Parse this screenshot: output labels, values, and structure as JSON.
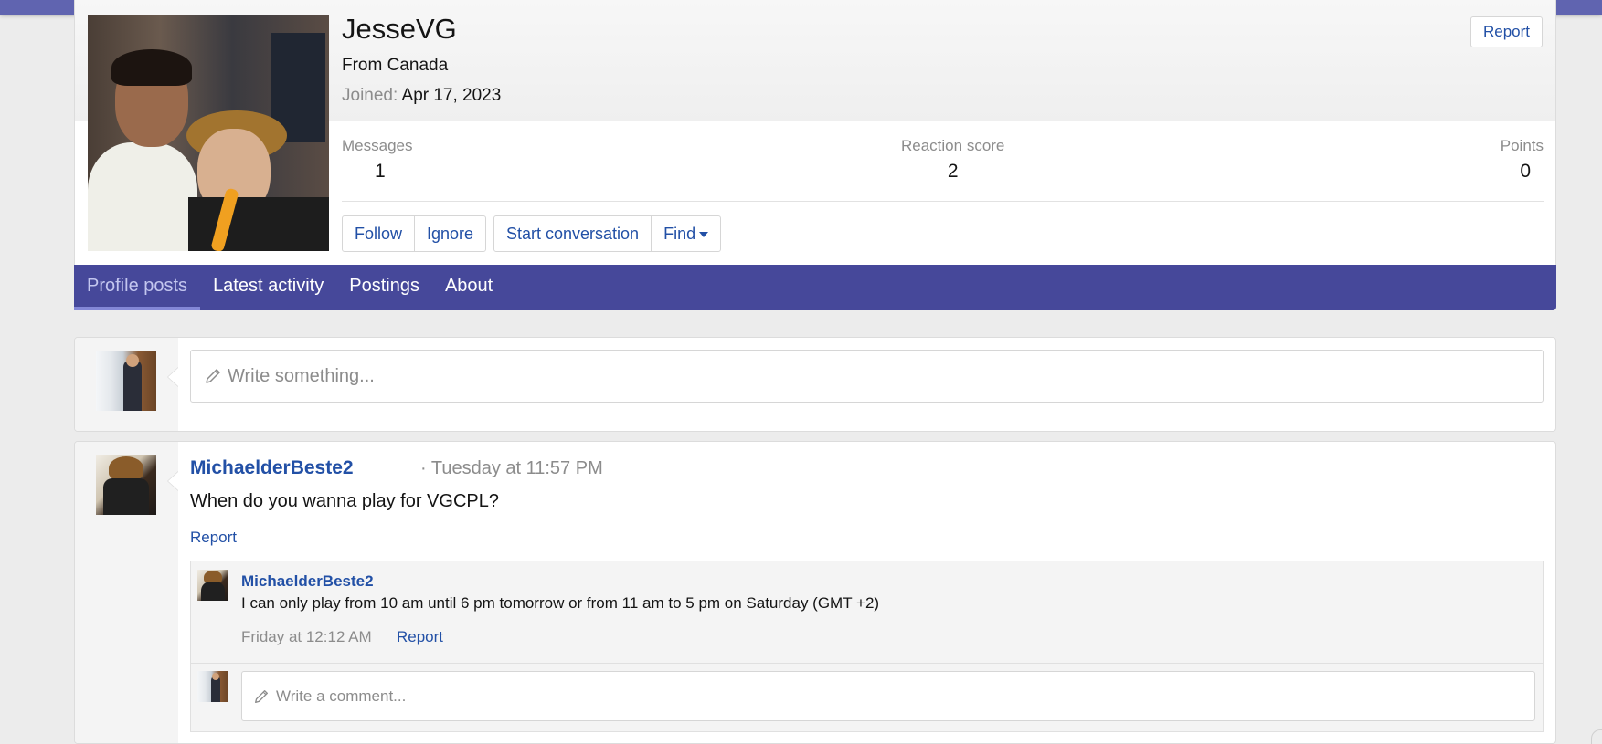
{
  "profile": {
    "username": "JesseVG",
    "location": "From Canada",
    "joined_label": "Joined:",
    "joined_date": "Apr 17, 2023",
    "report_label": "Report",
    "stats": {
      "messages_label": "Messages",
      "messages_value": "1",
      "reaction_label": "Reaction score",
      "reaction_value": "2",
      "points_label": "Points",
      "points_value": "0"
    },
    "actions": {
      "follow": "Follow",
      "ignore": "Ignore",
      "start_conversation": "Start conversation",
      "find": "Find"
    }
  },
  "tabs": [
    {
      "label": "Profile posts",
      "active": true
    },
    {
      "label": "Latest activity",
      "active": false
    },
    {
      "label": "Postings",
      "active": false
    },
    {
      "label": "About",
      "active": false
    }
  ],
  "composer": {
    "placeholder": "Write something..."
  },
  "post": {
    "author": "MichaelderBeste2",
    "time": "· Tuesday at 11:57 PM",
    "body": "When do you wanna play for VGCPL?",
    "report_label": "Report",
    "comment": {
      "author": "MichaelderBeste2",
      "body": "I can only play from 10 am until 6 pm tomorrow or from 11 am to 5 pm on Saturday (GMT +2)",
      "time": "Friday at 12:12 AM",
      "report_label": "Report"
    },
    "comment_placeholder": "Write a comment..."
  },
  "colors": {
    "nav": "#6064b0",
    "tabs_bar": "#46489a",
    "link": "#2250a6",
    "muted": "#8c8c8c"
  }
}
